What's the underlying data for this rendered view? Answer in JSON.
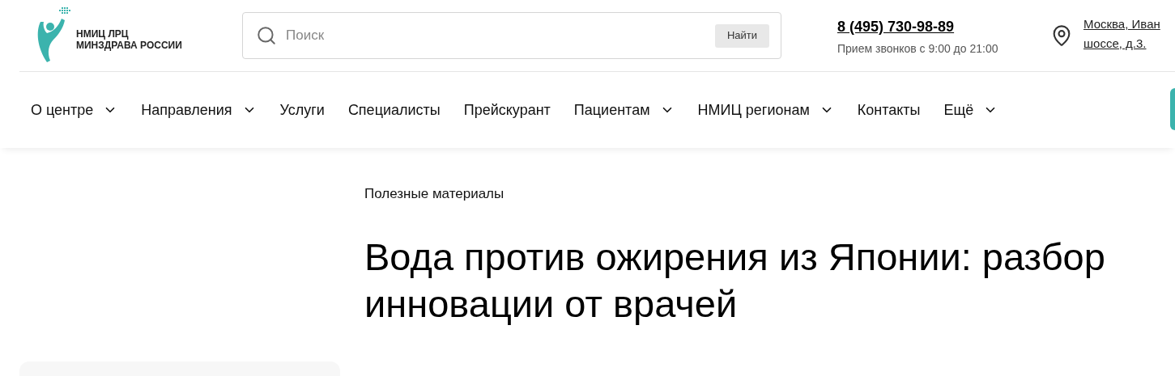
{
  "logo": {
    "line1": "НМИЦ ЛРЦ",
    "line2": "МИНЗДРАВА РОССИИ"
  },
  "search": {
    "placeholder": "Поиск",
    "button": "Найти"
  },
  "contact": {
    "phone": "8 (495) 730-98-89",
    "hours": "Прием звонков с 9:00 до 21:00"
  },
  "address": {
    "line1": "Москва, Иван",
    "line2": "шоссе, д.3."
  },
  "nav": [
    {
      "label": "О центре",
      "dropdown": true
    },
    {
      "label": "Направления",
      "dropdown": true
    },
    {
      "label": "Услуги",
      "dropdown": false
    },
    {
      "label": "Специалисты",
      "dropdown": false
    },
    {
      "label": "Прейскурант",
      "dropdown": false
    },
    {
      "label": "Пациентам",
      "dropdown": true
    },
    {
      "label": "НМИЦ регионам",
      "dropdown": true
    },
    {
      "label": "Контакты",
      "dropdown": false
    },
    {
      "label": "Ещё",
      "dropdown": true
    }
  ],
  "breadcrumb": "Полезные материалы",
  "title": "Вода против ожирения из Японии: разбор инновации от врачей"
}
